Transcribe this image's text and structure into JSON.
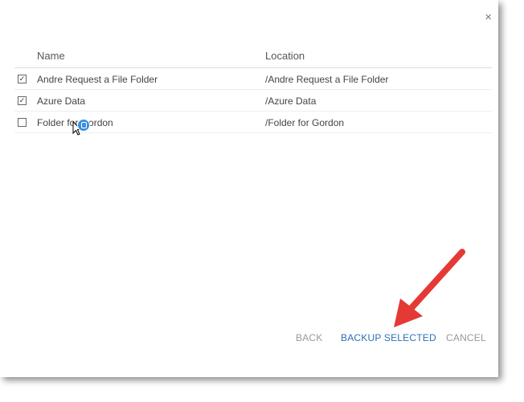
{
  "dialog": {
    "close_symbol": "×",
    "columns": {
      "name": "Name",
      "location": "Location"
    },
    "rows": [
      {
        "checked": true,
        "check_mark": "✓",
        "name": "Andre Request a File Folder",
        "location": "/Andre Request a File Folder"
      },
      {
        "checked": true,
        "check_mark": "✓",
        "name": "Azure Data",
        "location": "/Azure Data"
      },
      {
        "checked": false,
        "check_mark": "",
        "name": "Folder for Gordon",
        "location": "/Folder for Gordon"
      }
    ],
    "actions": {
      "back": "BACK",
      "backup_selected": "BACKUP SELECTED",
      "cancel": "CANCEL"
    }
  },
  "colors": {
    "accent": "#2c6fb5",
    "arrow": "#e53935",
    "muted": "#999999"
  },
  "icons": {
    "close": "close-icon",
    "pointer": "mouse-pointer-icon",
    "annotation": "red-arrow-icon"
  }
}
